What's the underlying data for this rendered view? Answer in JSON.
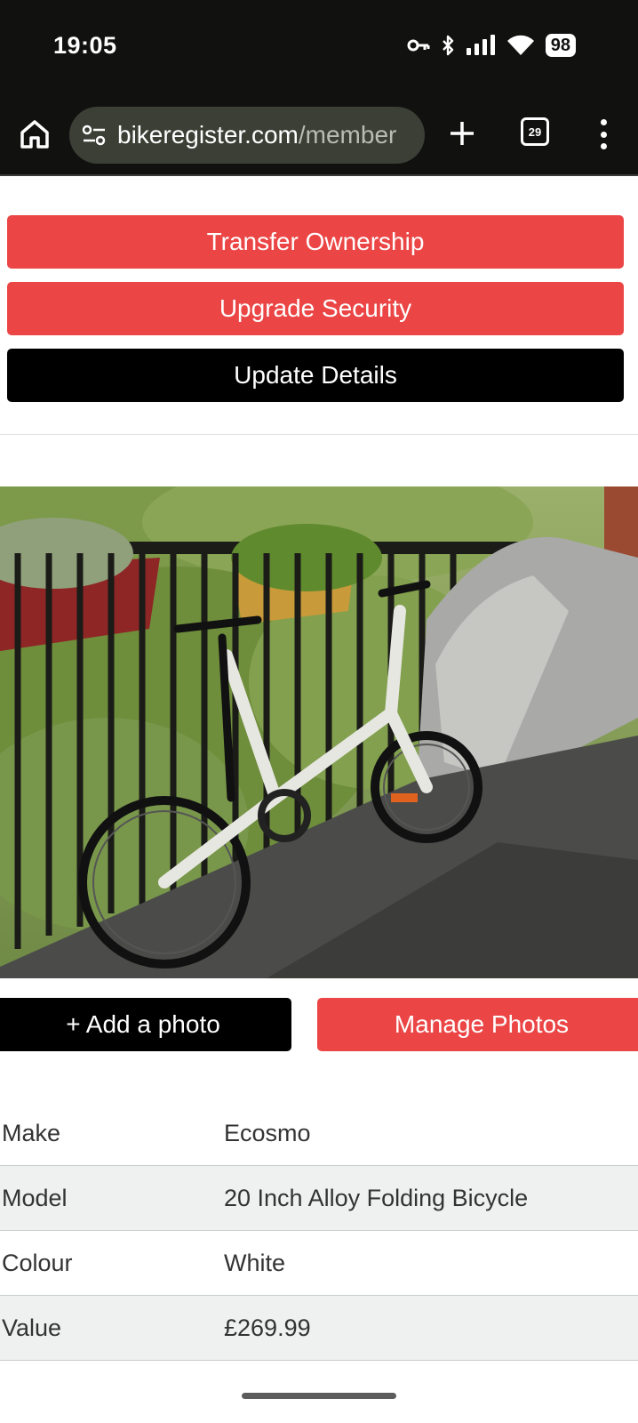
{
  "status_bar": {
    "time": "19:05",
    "battery": "98",
    "icons": [
      "vpn-key-icon",
      "bluetooth-icon",
      "signal-icon",
      "wifi-icon",
      "battery-icon"
    ]
  },
  "browser": {
    "url_host": "bikeregister.com",
    "url_path": "/member",
    "tab_count": "29"
  },
  "actions": {
    "transfer_label": "Transfer Ownership",
    "upgrade_label": "Upgrade Security",
    "update_label": "Update Details"
  },
  "photo_actions": {
    "add_label": "+ Add a photo",
    "manage_label": "Manage Photos"
  },
  "details": [
    {
      "label": "Make",
      "value": "Ecosmo"
    },
    {
      "label": "Model",
      "value": "20 Inch Alloy Folding Bicycle"
    },
    {
      "label": "Colour",
      "value": "White"
    },
    {
      "label": "Value",
      "value": "£269.99"
    }
  ],
  "colors": {
    "accent_red": "#eb4545",
    "black": "#000000",
    "chrome": "#111210"
  }
}
